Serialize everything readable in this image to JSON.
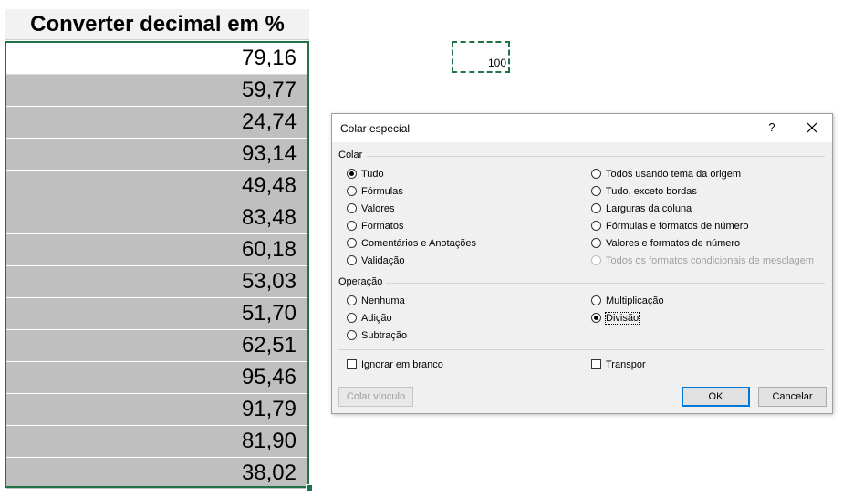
{
  "sheet": {
    "header": "Converter decimal em %",
    "values": [
      "79,16",
      "59,77",
      "24,74",
      "93,14",
      "49,48",
      "83,48",
      "60,18",
      "53,03",
      "51,70",
      "62,51",
      "95,46",
      "91,79",
      "81,90",
      "38,02"
    ],
    "copied_value": "100"
  },
  "dialog": {
    "title": "Colar especial",
    "help": "?",
    "colar_label": "Colar",
    "paste_left": [
      "Tudo",
      "Fórmulas",
      "Valores",
      "Formatos",
      "Comentários e Anotações",
      "Validação"
    ],
    "paste_right": [
      "Todos usando tema da origem",
      "Tudo, exceto bordas",
      "Larguras da coluna",
      "Fórmulas e formatos de número",
      "Valores e formatos de número",
      "Todos os formatos condicionais de mesclagem"
    ],
    "operacao_label": "Operação",
    "op_left": [
      "Nenhuma",
      "Adição",
      "Subtração"
    ],
    "op_right": [
      "Multiplicação",
      "Divisão"
    ],
    "skip_blanks": "Ignorar em branco",
    "transpose": "Transpor",
    "paste_link": "Colar vínculo",
    "ok": "OK",
    "cancel": "Cancelar"
  }
}
